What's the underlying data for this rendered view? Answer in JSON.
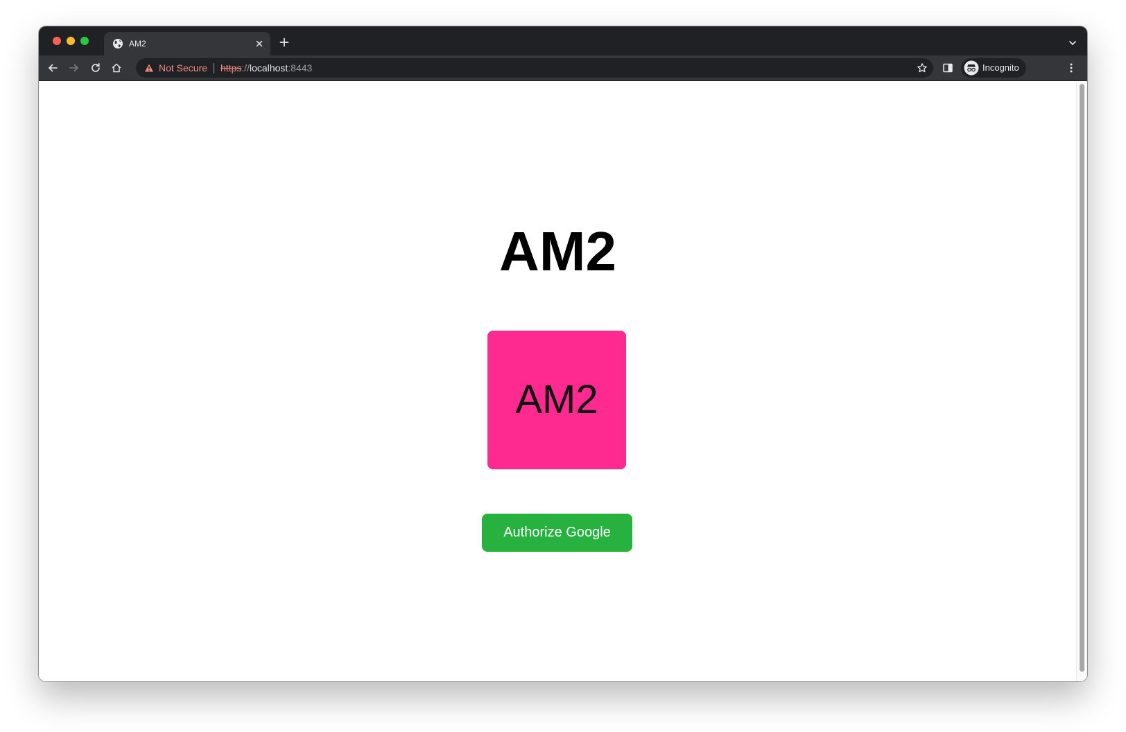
{
  "browser": {
    "tab": {
      "title": "AM2",
      "favicon": "globe-icon"
    },
    "toolbar": {
      "security_label": "Not Secure",
      "url_scheme": "https",
      "url_separator": "://",
      "url_host": "localhost",
      "url_port": ":8443",
      "profile_label": "Incognito"
    },
    "icons": {
      "back": "back-arrow-icon",
      "forward": "forward-arrow-icon",
      "reload": "reload-icon",
      "home": "home-icon",
      "warning": "warning-icon",
      "bookmark": "star-icon",
      "side_panel": "side-panel-icon",
      "profile": "incognito-icon",
      "menu": "more-vert-icon",
      "close_tab": "close-icon",
      "new_tab": "plus-icon",
      "tab_search": "chevron-down-icon"
    }
  },
  "page": {
    "title": "AM2",
    "logo_text": "AM2",
    "authorize_button": "Authorize Google"
  },
  "colors": {
    "logo_background": "#ff2a8f",
    "button_background": "#27b23f",
    "warning_text": "#f28b82",
    "chrome_dark": "#202124",
    "chrome_toolbar": "#35363a"
  }
}
